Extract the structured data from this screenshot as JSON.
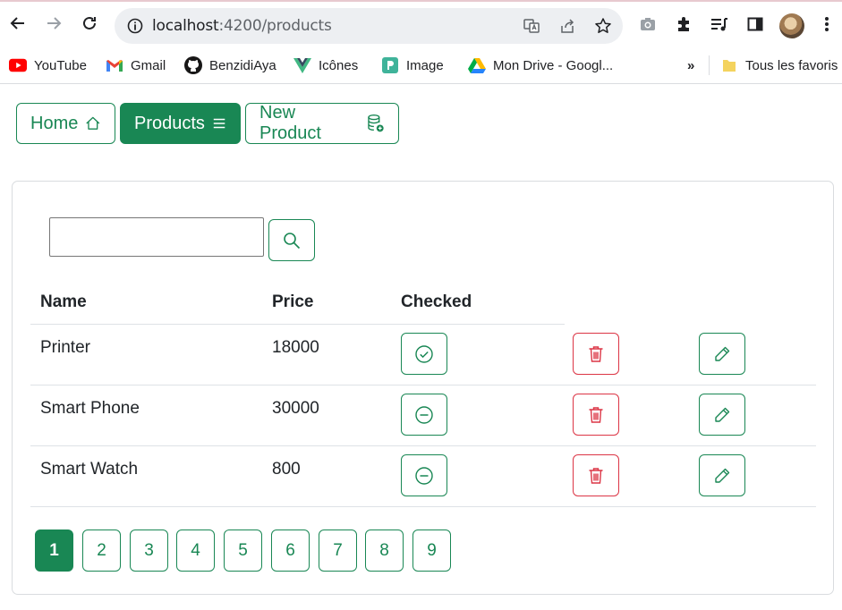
{
  "browser": {
    "url_host": "localhost",
    "url_path": ":4200/products",
    "bookmarks": [
      {
        "label": "YouTube",
        "icon": "youtube-icon"
      },
      {
        "label": "Gmail",
        "icon": "gmail-icon"
      },
      {
        "label": "BenzidiAya",
        "icon": "github-icon"
      },
      {
        "label": "Icônes",
        "icon": "vue-icon"
      },
      {
        "label": "Image",
        "icon": "image-icon"
      },
      {
        "label": "Mon Drive - Googl...",
        "icon": "google-drive-icon"
      }
    ],
    "overflow": "»",
    "all_bookmarks": "Tous les favoris"
  },
  "nav": {
    "home": "Home",
    "products": "Products",
    "new_product": "New Product"
  },
  "search": {
    "value": ""
  },
  "table": {
    "headers": [
      "Name",
      "Price",
      "Checked"
    ],
    "rows": [
      {
        "name": "Printer",
        "price": "18000",
        "checked": true
      },
      {
        "name": "Smart Phone",
        "price": "30000",
        "checked": false
      },
      {
        "name": "Smart Watch",
        "price": "800",
        "checked": false
      }
    ]
  },
  "pagination": {
    "pages": [
      "1",
      "2",
      "3",
      "4",
      "5",
      "6",
      "7",
      "8",
      "9"
    ],
    "current": "1"
  },
  "colors": {
    "primary": "#198754",
    "danger": "#dc3545",
    "border": "#dee2e6"
  }
}
